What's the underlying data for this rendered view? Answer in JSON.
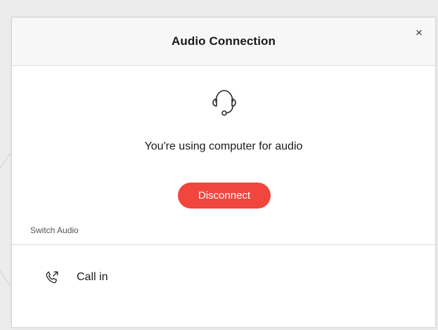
{
  "dialog": {
    "title": "Audio Connection",
    "close_glyph": "×",
    "status_icon": "headset-icon",
    "status_text": "You're using computer for audio",
    "disconnect_label": "Disconnect",
    "section_label": "Switch Audio",
    "options": [
      {
        "icon": "phone-call-in-icon",
        "label": "Call in"
      }
    ]
  },
  "colors": {
    "disconnect_button": "#f0463d",
    "header_background": "#f7f7f7",
    "backdrop": "#ececec"
  }
}
